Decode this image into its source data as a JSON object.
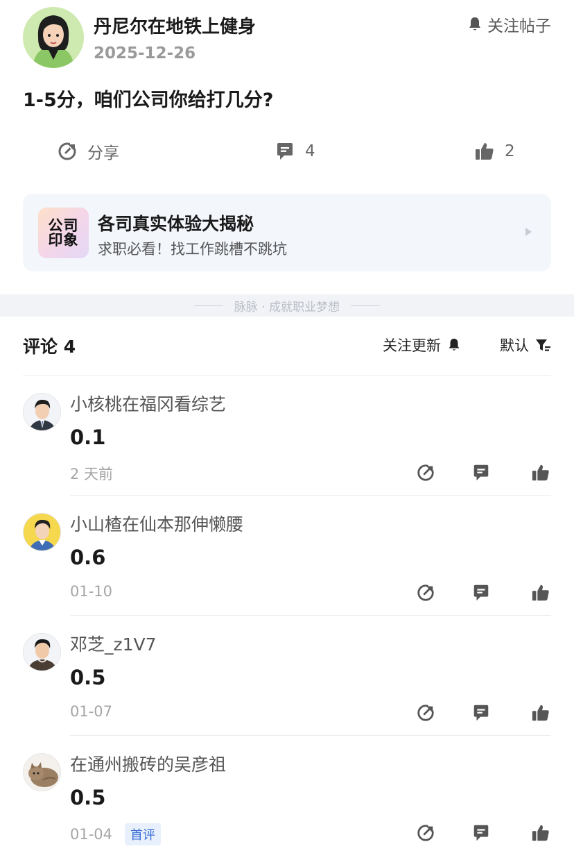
{
  "post": {
    "author": "丹尼尔在地铁上健身",
    "date": "2025-12-26",
    "follow_label": "关注帖子",
    "content": "1-5分，咱们公司你给打几分?",
    "actions": {
      "share_label": "分享",
      "comment_count": "4",
      "like_count": "2"
    }
  },
  "promo": {
    "logo_line1": "公司",
    "logo_line2": "印象",
    "title": "各司真实体验大揭秘",
    "subtitle": "求职必看！找工作跳槽不跳坑"
  },
  "slogan": "脉脉 · 成就职业梦想",
  "comments_header": {
    "title": "评论 4",
    "follow_updates_label": "关注更新",
    "sort_label": "默认"
  },
  "comments": [
    {
      "name": "小核桃在福冈看综艺",
      "text": "0.1",
      "time": "2 天前",
      "badge": "",
      "avatar": "man-suit-avatar"
    },
    {
      "name": "小山楂在仙本那伸懒腰",
      "text": "0.6",
      "time": "01-10",
      "badge": "",
      "avatar": "man-yellow-bg-avatar"
    },
    {
      "name": "邓芝_z1V7",
      "text": "0.5",
      "time": "01-07",
      "badge": "",
      "avatar": "man-hoodie-avatar"
    },
    {
      "name": "在通州搬砖的吴彦祖",
      "text": "0.5",
      "time": "01-04",
      "badge": "首评",
      "avatar": "cat-photo-avatar"
    }
  ],
  "colors": {
    "accent_blue": "#3b6fd6",
    "muted_text": "#9a9a9a",
    "icon_gray": "#666666",
    "card_bg": "#f3f6fb"
  }
}
